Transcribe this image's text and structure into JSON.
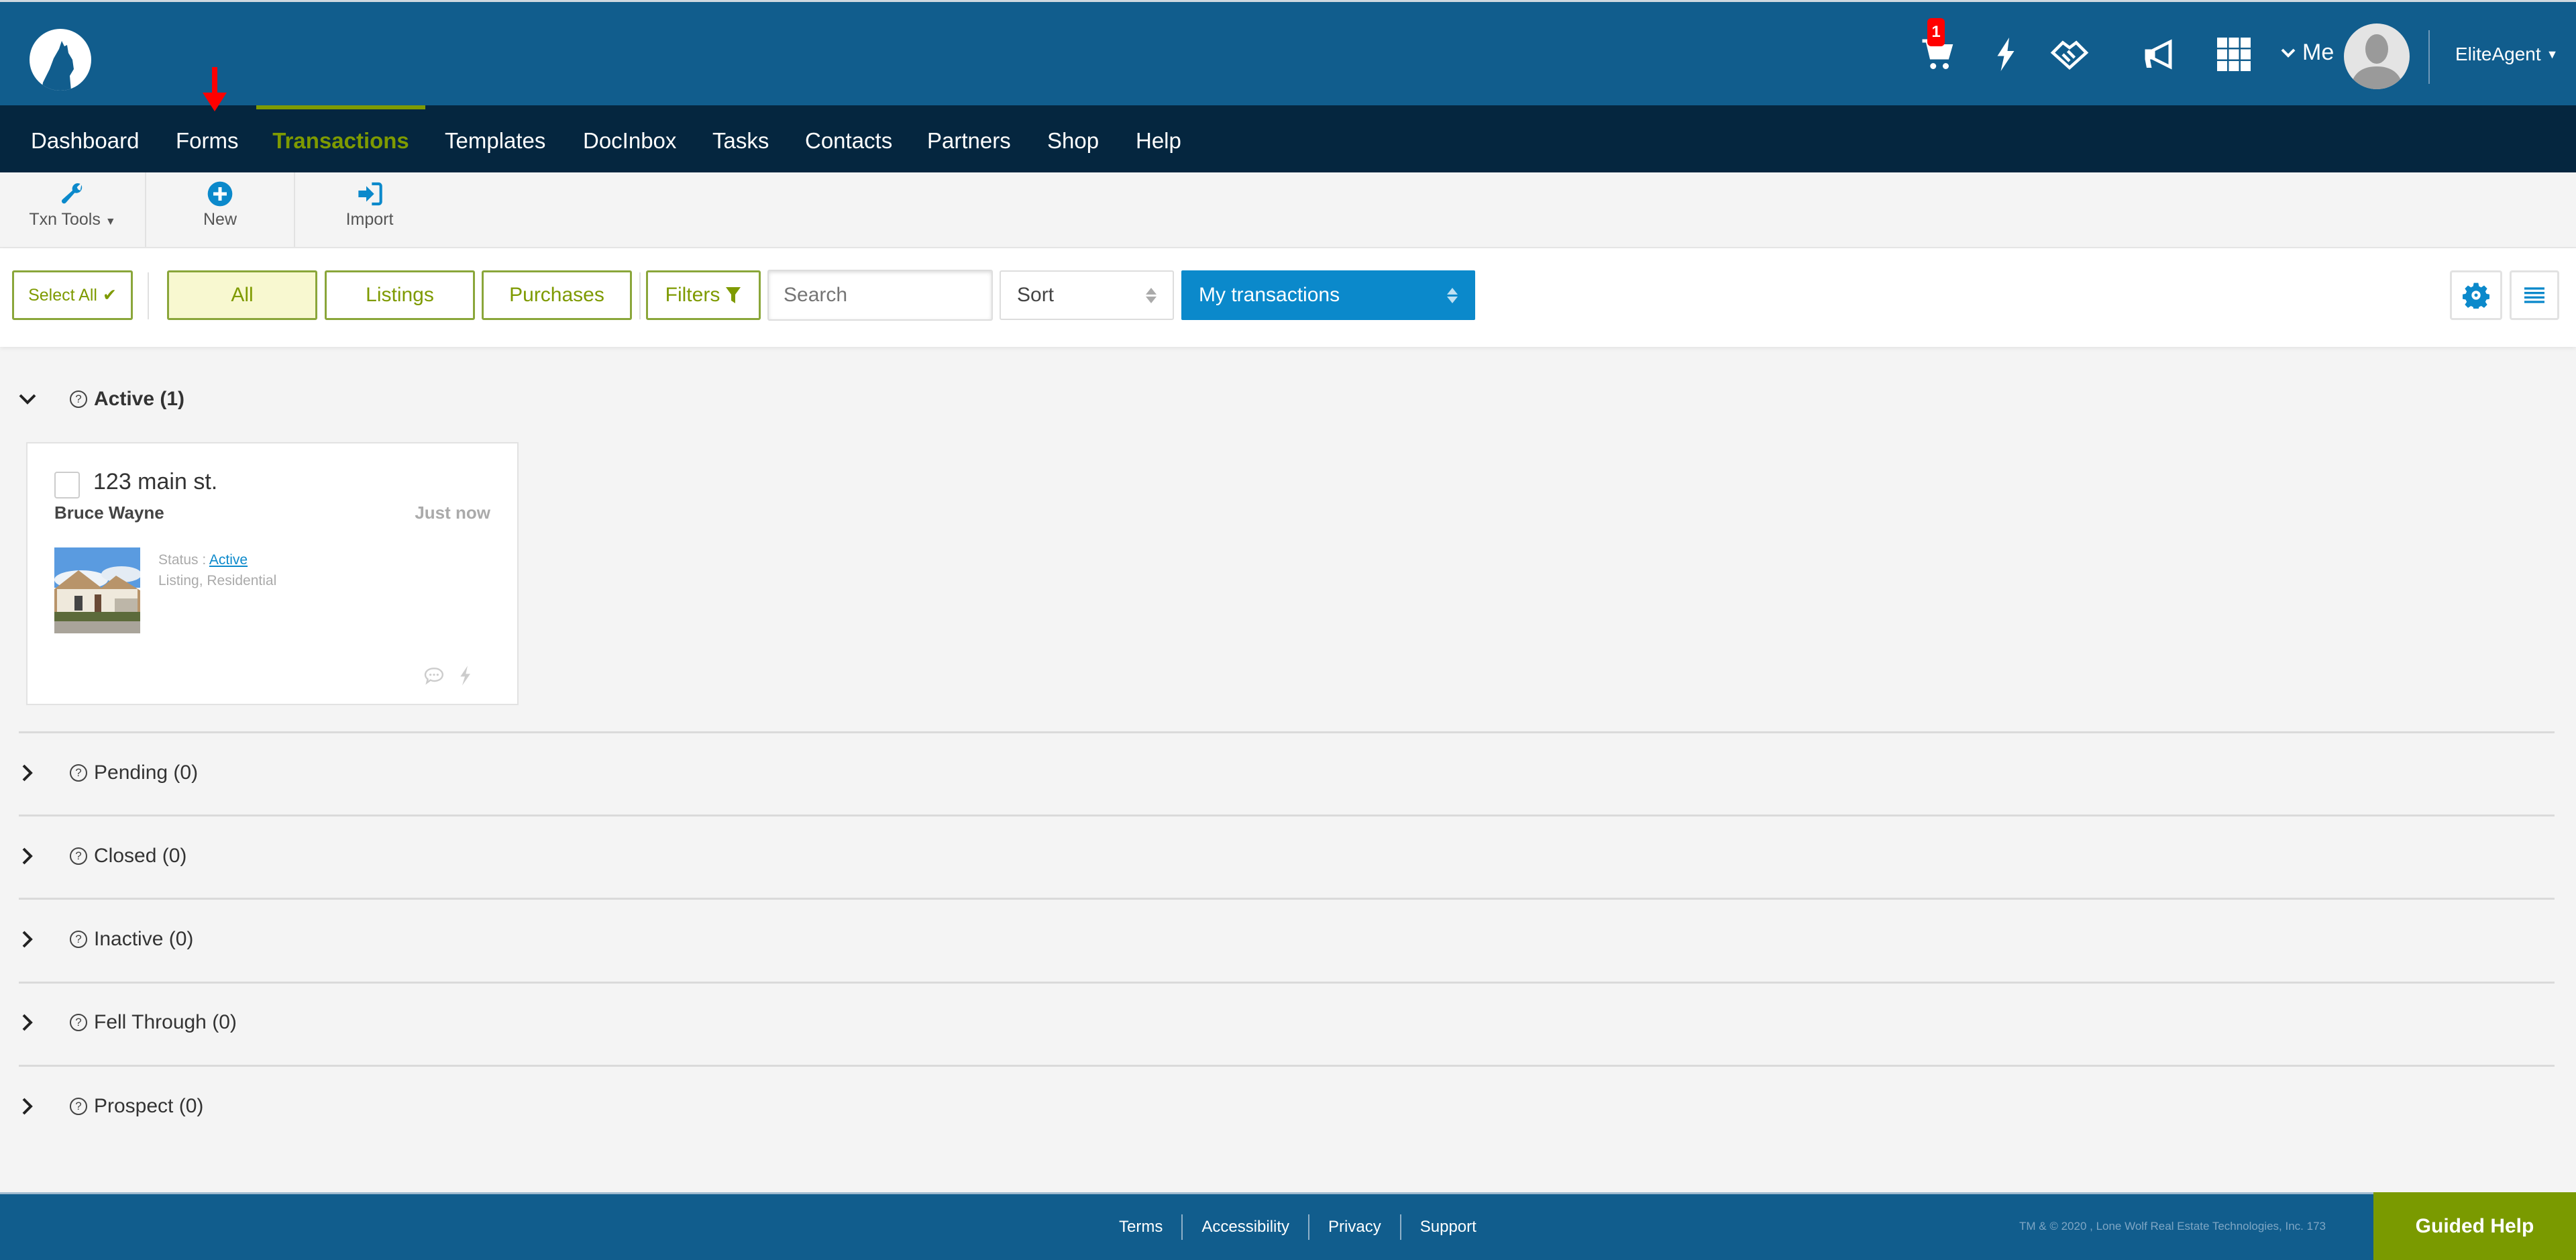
{
  "header": {
    "logo": "lone-wolf-logo",
    "cart_badge": "1",
    "icons": [
      "cart-icon",
      "lightning-icon",
      "handshake-icon",
      "megaphone-icon",
      "apps-grid-icon"
    ],
    "me_label": "Me",
    "account_label": "EliteAgent"
  },
  "nav": {
    "items": [
      {
        "label": "Dashboard"
      },
      {
        "label": "Forms"
      },
      {
        "label": "Transactions",
        "active": true
      },
      {
        "label": "Templates"
      },
      {
        "label": "DocInbox"
      },
      {
        "label": "Tasks"
      },
      {
        "label": "Contacts"
      },
      {
        "label": "Partners"
      },
      {
        "label": "Shop"
      },
      {
        "label": "Help"
      }
    ]
  },
  "toolbar": {
    "txn_tools": "Txn Tools",
    "new": "New",
    "import": "Import"
  },
  "filters": {
    "select_all": "Select All",
    "tabs": [
      "All",
      "Listings",
      "Purchases"
    ],
    "selected_tab": "All",
    "filters_label": "Filters",
    "search_placeholder": "Search",
    "sort_label": "Sort",
    "scope_label": "My transactions"
  },
  "sections": [
    {
      "label": "Active (1)",
      "expanded": true
    },
    {
      "label": "Pending (0)"
    },
    {
      "label": "Closed (0)"
    },
    {
      "label": "Inactive (0)"
    },
    {
      "label": "Fell Through (0)"
    },
    {
      "label": "Prospect (0)"
    }
  ],
  "card": {
    "address": "123 main st.",
    "client": "Bruce Wayne",
    "time": "Just now",
    "status_prefix": "Status : ",
    "status": "Active",
    "type": "Listing, Residential"
  },
  "footer": {
    "links": [
      "Terms",
      "Accessibility",
      "Privacy",
      "Support"
    ],
    "copyright": "TM & © 2020 , Lone Wolf Real Estate Technologies, Inc. 173",
    "guided_help": "Guided Help"
  },
  "colors": {
    "header": "#115d8d",
    "nav": "#05263f",
    "accent_green": "#7e9a00",
    "primary_blue": "#0b89cb",
    "badge_red": "#ff0000"
  }
}
